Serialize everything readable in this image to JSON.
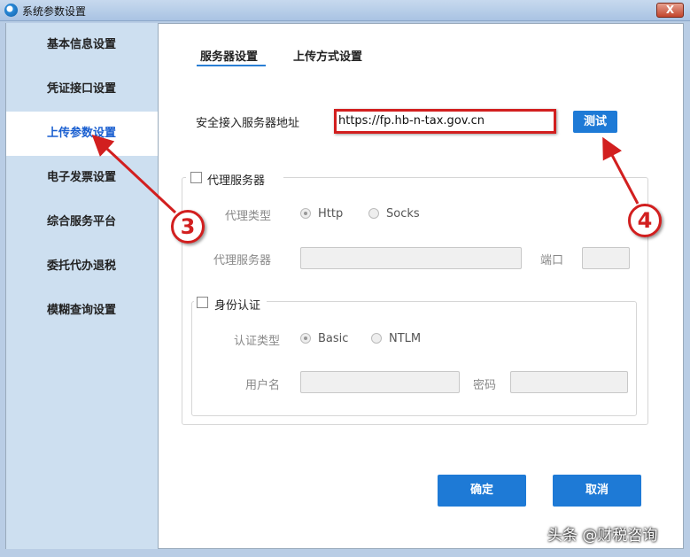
{
  "window": {
    "title": "系统参数设置",
    "close_label": "X"
  },
  "sidebar": {
    "items": [
      {
        "label": "基本信息设置"
      },
      {
        "label": "凭证接口设置"
      },
      {
        "label": "上传参数设置",
        "selected": true
      },
      {
        "label": "电子发票设置"
      },
      {
        "label": "综合服务平台"
      },
      {
        "label": "委托代办退税"
      },
      {
        "label": "模糊查询设置"
      }
    ]
  },
  "tabs": [
    {
      "label": "服务器设置",
      "active": true
    },
    {
      "label": "上传方式设置"
    }
  ],
  "server": {
    "label": "安全接入服务器地址",
    "value": "https://fp.hb-n-tax.gov.cn",
    "test_label": "测试"
  },
  "proxy": {
    "checkbox_label": "代理服务器",
    "checked": false,
    "type_label": "代理类型",
    "type_options": [
      "Http",
      "Socks"
    ],
    "type_selected": "Http",
    "server_label": "代理服务器",
    "server_value": "",
    "port_label": "端口",
    "port_value": ""
  },
  "auth": {
    "checkbox_label": "身份认证",
    "checked": false,
    "type_label": "认证类型",
    "type_options": [
      "Basic",
      "NTLM"
    ],
    "type_selected": "Basic",
    "user_label": "用户名",
    "user_value": "",
    "password_label": "密码",
    "password_value": ""
  },
  "footer": {
    "ok_label": "确定",
    "cancel_label": "取消"
  },
  "annotations": [
    "3",
    "4"
  ],
  "watermark": "头条 @财税咨询",
  "colors": {
    "accent": "#1e7ad6",
    "annotation": "#d21f1f"
  }
}
